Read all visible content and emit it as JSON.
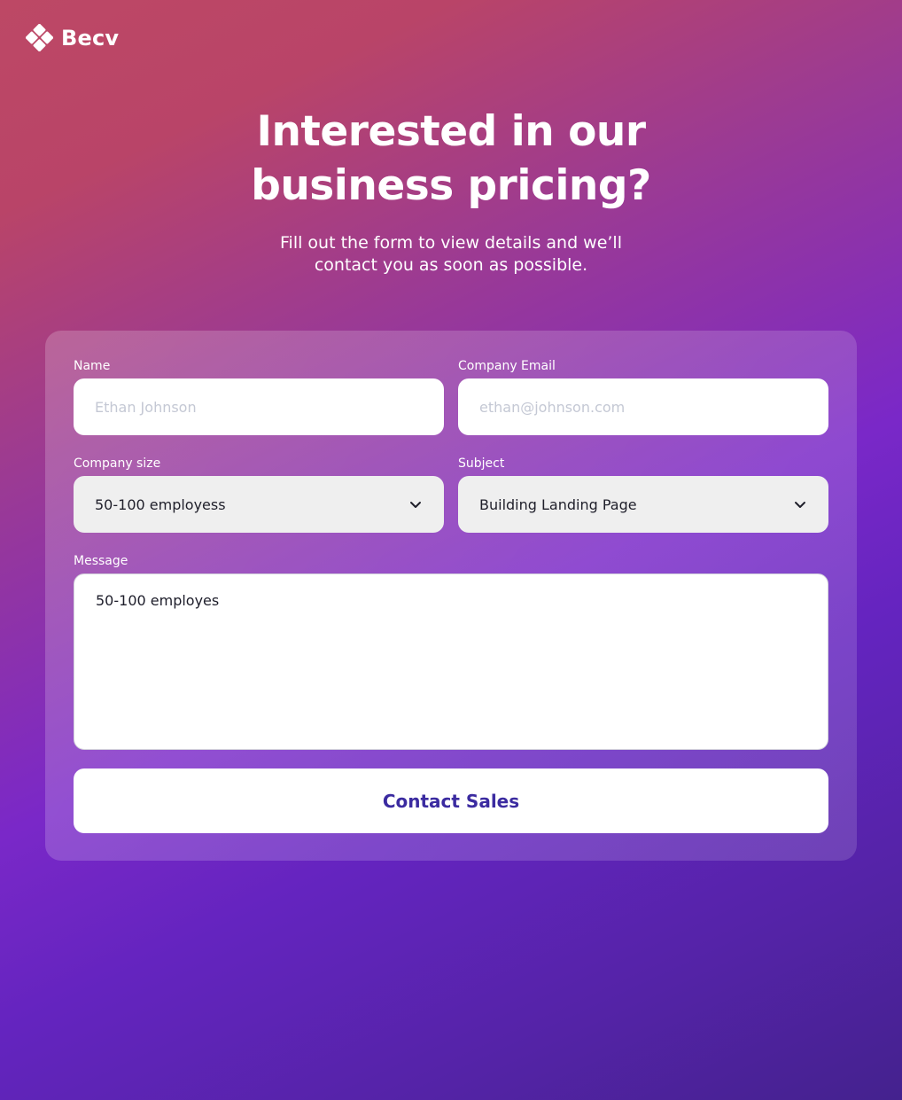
{
  "brand": {
    "name": "Becv",
    "logo_icon": "diamond-grid-icon"
  },
  "hero": {
    "headline_line1": "Interested in our",
    "headline_line2": "business pricing?",
    "subtitle_line1": "Fill out the form to view details and we’ll",
    "subtitle_line2": "contact you as soon as possible."
  },
  "form": {
    "name": {
      "label": "Name",
      "placeholder": "Ethan Johnson",
      "value": ""
    },
    "email": {
      "label": "Company Email",
      "placeholder": "ethan@johnson.com",
      "value": ""
    },
    "company_size": {
      "label": "Company size",
      "selected": "50-100 employess",
      "icon": "chevron-down-icon"
    },
    "subject": {
      "label": "Subject",
      "selected": "Building Landing Page",
      "icon": "chevron-down-icon"
    },
    "message": {
      "label": "Message",
      "value": "50-100 employes"
    },
    "submit_label": "Contact Sales"
  },
  "colors": {
    "button_text": "#3b2ba0",
    "select_background": "#efefef",
    "placeholder": "#c4c8d4",
    "gradient_start": "#bd4865",
    "gradient_mid": "#7a28c8",
    "gradient_end": "#44228e"
  }
}
